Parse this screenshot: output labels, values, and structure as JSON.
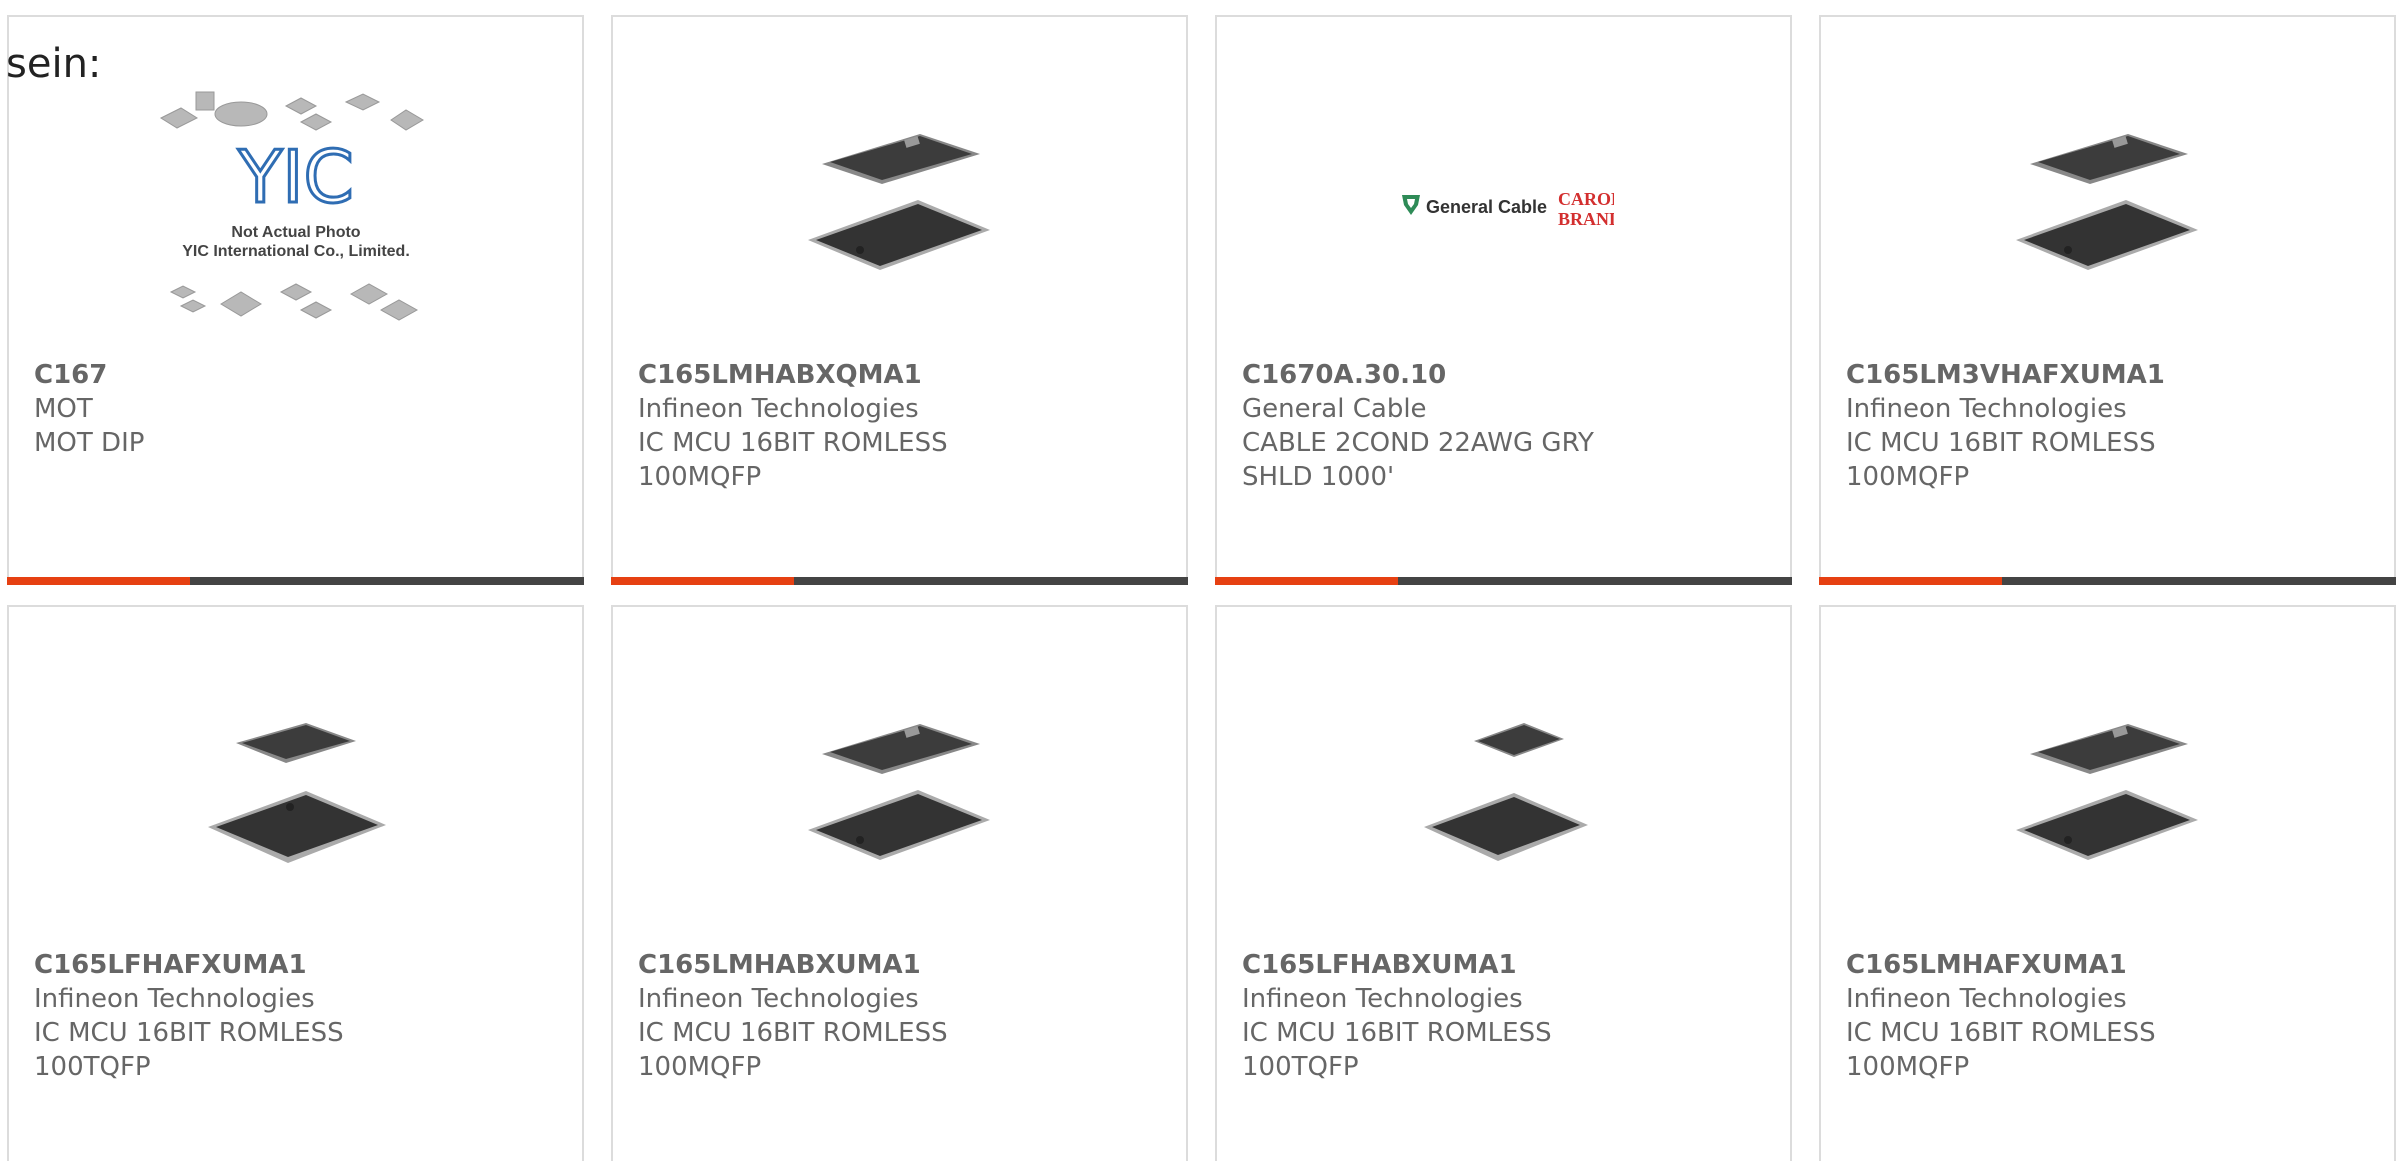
{
  "heading": "sein:",
  "accent_color": "#e64012",
  "bar_color": "#444444",
  "placeholder_image": {
    "line1": "Not Actual Photo",
    "line2": "YIC International Co., Limited.",
    "logo": "YIC"
  },
  "brand_logo": {
    "left": "General Cable",
    "right_top": "CAROL",
    "right_bottom": "BRAND"
  },
  "products": [
    {
      "part": "C167",
      "manufacturer": "MOT",
      "description": "MOT DIP",
      "image": "placeholder-photo"
    },
    {
      "part": "C165LMHABXQMA1",
      "manufacturer": "Infineon Technologies",
      "description": "IC MCU 16BIT ROMLESS 100MQFP",
      "image": "qfp-chip-icon"
    },
    {
      "part": "C1670A.30.10",
      "manufacturer": "General Cable",
      "description": "CABLE 2COND 22AWG GRY SHLD 1000'",
      "image": "general-cable-logo"
    },
    {
      "part": "C165LM3VHAFXUMA1",
      "manufacturer": "Infineon Technologies",
      "description": "IC MCU 16BIT ROMLESS 100MQFP",
      "image": "qfp-chip-icon"
    },
    {
      "part": "C165LFHAFXUMA1",
      "manufacturer": "Infineon Technologies",
      "description": "IC MCU 16BIT ROMLESS 100TQFP",
      "image": "tqfp-chip-icon"
    },
    {
      "part": "C165LMHABXUMA1",
      "manufacturer": "Infineon Technologies",
      "description": "IC MCU 16BIT ROMLESS 100MQFP",
      "image": "qfp-chip-icon"
    },
    {
      "part": "C165LFHABXUMA1",
      "manufacturer": "Infineon Technologies",
      "description": "IC MCU 16BIT ROMLESS 100TQFP",
      "image": "tqfp-chip-icon"
    },
    {
      "part": "C165LMHAFXUMA1",
      "manufacturer": "Infineon Technologies",
      "description": "IC MCU 16BIT ROMLESS 100MQFP",
      "image": "qfp-chip-icon"
    }
  ]
}
